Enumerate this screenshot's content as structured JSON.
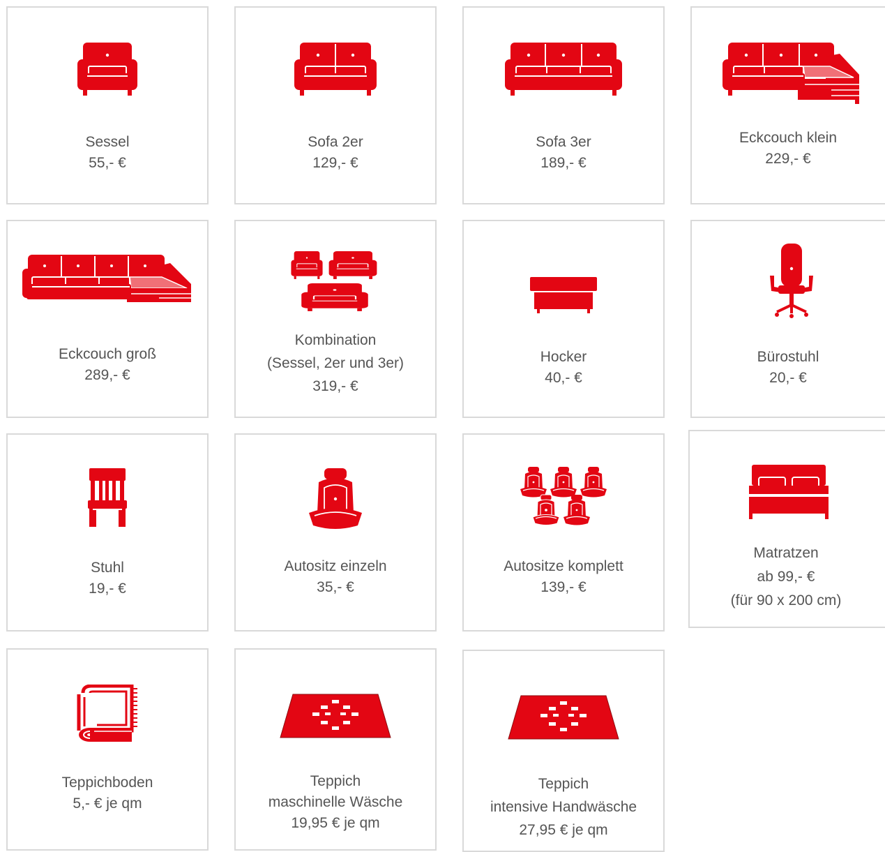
{
  "accent_color": "#e30613",
  "items": [
    {
      "icon": "armchair-icon",
      "name": "Sessel",
      "price": "55,- €"
    },
    {
      "icon": "sofa-2-seat-icon",
      "name": "Sofa 2er",
      "price": "129,- €"
    },
    {
      "icon": "sofa-3-seat-icon",
      "name": "Sofa 3er",
      "price": "189,- €"
    },
    {
      "icon": "corner-couch-small-icon",
      "name": "Eckcouch klein",
      "price": "229,- €"
    },
    {
      "icon": "corner-couch-large-icon",
      "name": "Eckcouch groß",
      "price": "289,- €"
    },
    {
      "icon": "sofa-combination-icon",
      "name": "Kombination",
      "detail": "(Sessel, 2er und 3er)",
      "price": "319,- €"
    },
    {
      "icon": "stool-icon",
      "name": "Hocker",
      "price": "40,- €"
    },
    {
      "icon": "office-chair-icon",
      "name": "Bürostuhl",
      "price": "20,- €"
    },
    {
      "icon": "chair-icon",
      "name": "Stuhl",
      "price": "19,- €"
    },
    {
      "icon": "car-seat-icon",
      "name": "Autositz einzeln",
      "price": "35,- €"
    },
    {
      "icon": "car-seats-complete-icon",
      "name": "Autositze komplett",
      "price": "139,- €"
    },
    {
      "icon": "bed-mattress-icon",
      "name": "Matratzen",
      "price": "ab 99,- €",
      "note": "(für 90 x 200 cm)"
    },
    {
      "icon": "carpet-roll-icon",
      "name": "Teppichboden",
      "price": "5,- € je qm"
    },
    {
      "icon": "rug-icon",
      "name": "Teppich",
      "detail": "maschinelle Wäsche",
      "price": "19,95 € je qm"
    },
    {
      "icon": "rug-icon",
      "name": "Teppich",
      "detail": "intensive Handwäsche",
      "price": "27,95 € je qm"
    }
  ]
}
